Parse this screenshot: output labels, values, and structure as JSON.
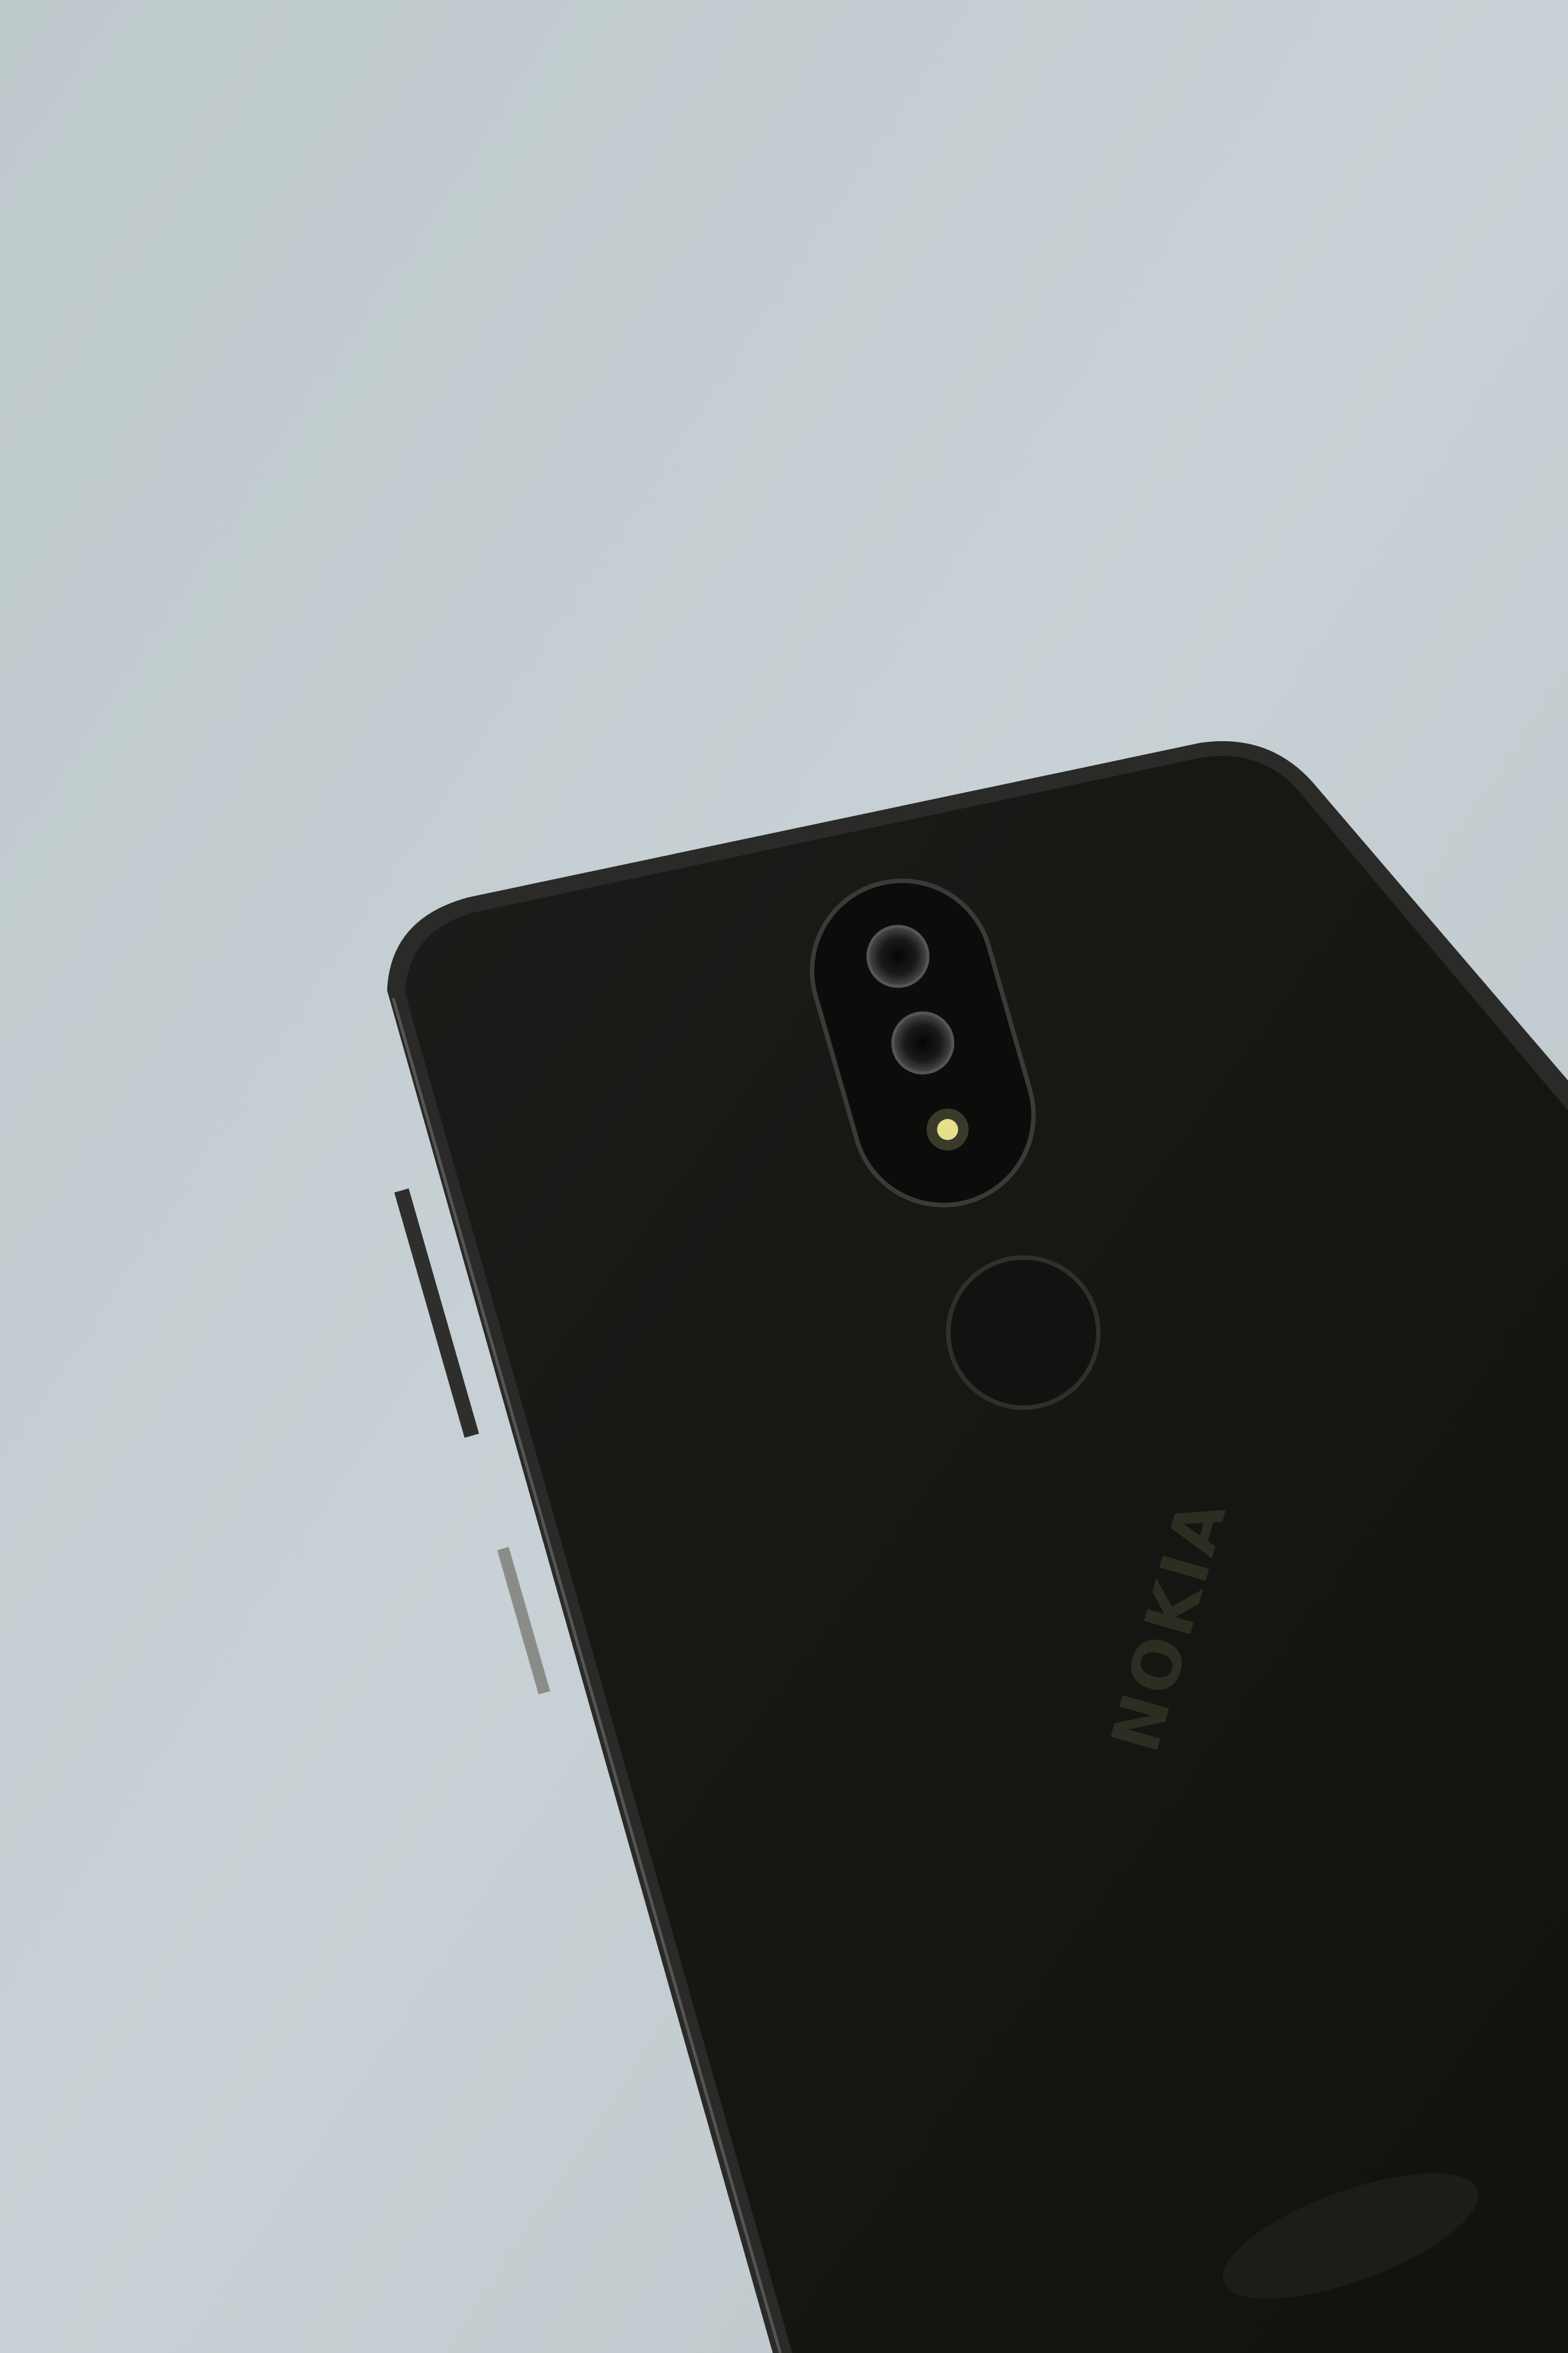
{
  "scene": {
    "description_label": "Photo",
    "phone_logo": "NOKIA"
  },
  "colors": {
    "background": "#c4cdd0",
    "phone_body": "#141611",
    "logo": "#2c2e22",
    "flash": "#e6e08a"
  }
}
